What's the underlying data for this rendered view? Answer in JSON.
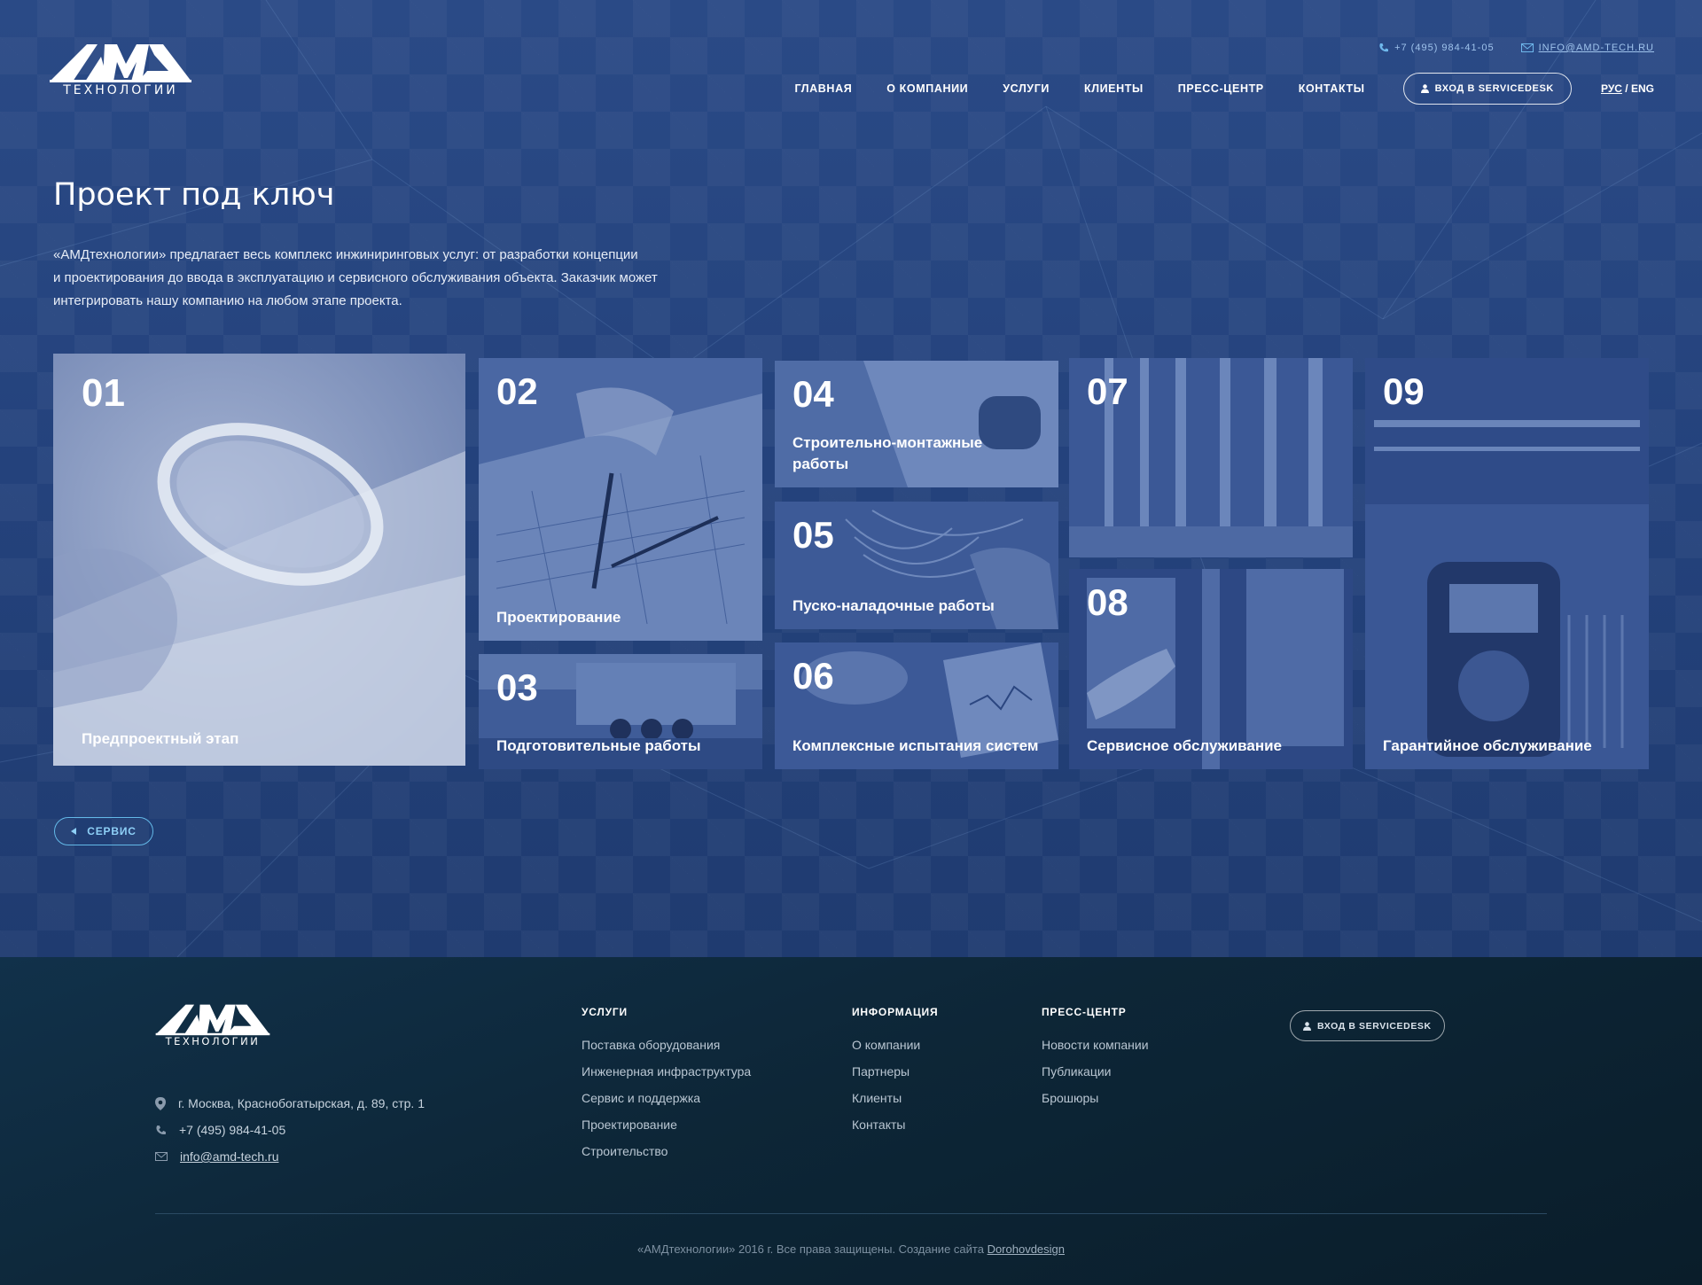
{
  "logo": {
    "main": "AMD",
    "sub": "ТЕХНОЛОГИИ"
  },
  "header": {
    "phone": "+7 (495) 984-41-05",
    "email": "INFO@AMD-TECH.RU",
    "nav": [
      "ГЛАВНАЯ",
      "О КОМПАНИИ",
      "УСЛУГИ",
      "КЛИЕНТЫ",
      "ПРЕСС-ЦЕНТР",
      "КОНТАКТЫ"
    ],
    "servicedesk": "ВХОД В SERVICEDESK",
    "lang_ru": "РУС",
    "lang_sep": "/",
    "lang_en": "ENG"
  },
  "main": {
    "title": "Проект под ключ",
    "intro_lines": [
      "«АМДтехнологии» предлагает весь комплекс инжиниринговых услуг: от разработки концепции",
      "и проектирования до ввода в эксплуатацию и сервисного обслуживания объекта. Заказчик может",
      "интегрировать нашу компанию на любом этапе проекта."
    ],
    "back_button": "СЕРВИС"
  },
  "tiles": [
    {
      "num": "01",
      "label": "Предпроектный этап"
    },
    {
      "num": "02",
      "label": "Проектирование"
    },
    {
      "num": "03",
      "label": "Подготовительные работы"
    },
    {
      "num": "04",
      "label": "Строительно-монтажные работы"
    },
    {
      "num": "05",
      "label": "Пуско-наладочные работы"
    },
    {
      "num": "06",
      "label": "Комплексные испытания систем"
    },
    {
      "num": "07",
      "label": ""
    },
    {
      "num": "08",
      "label": "Сервисное обслуживание"
    },
    {
      "num": "09",
      "label": "Гарантийное обслуживание"
    }
  ],
  "footer": {
    "address": "г. Москва, Краснобогатырская, д. 89, стр. 1",
    "phone": "+7 (495) 984-41-05",
    "email": "info@amd-tech.ru",
    "columns": [
      {
        "title": "УСЛУГИ",
        "links": [
          "Поставка оборудования",
          "Инженерная инфраструктура",
          "Сервис и поддержка",
          "Проектирование",
          "Строительство"
        ]
      },
      {
        "title": "ИНФОРМАЦИЯ",
        "links": [
          "О компании",
          "Партнеры",
          "Клиенты",
          "Контакты"
        ]
      },
      {
        "title": "ПРЕСС-ЦЕНТР",
        "links": [
          "Новости компании",
          "Публикации",
          "Брошюры"
        ]
      }
    ],
    "servicedesk": "ВХОД В SERVICEDESK",
    "copyright": "«АМДтехнологии» 2016 г. Все права защищены. Создание сайта",
    "credit": "Dorohovdesign"
  },
  "colors": {
    "hero_bg": "#24427c",
    "footer_bg": "#0d2637",
    "accent": "#63b9e8",
    "tile_overlay": "#3c5a98"
  }
}
